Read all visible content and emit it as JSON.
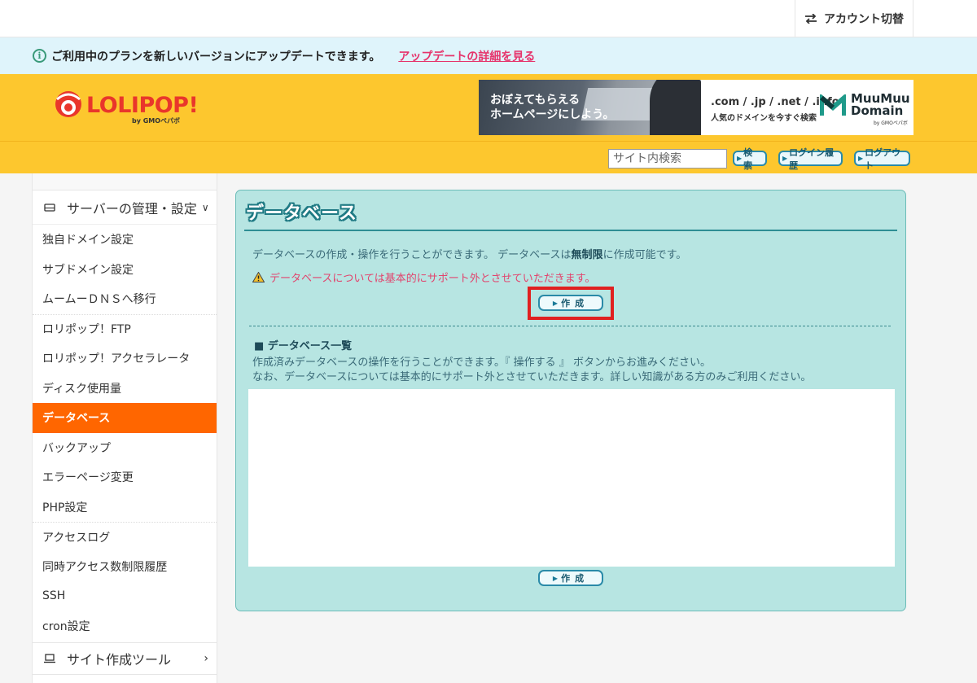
{
  "topbar": {
    "account_switch_label": "アカウント切替"
  },
  "notice": {
    "message": "ご利用中のプランを新しいバージョンにアップデートできます。",
    "link_label": "アップデートの詳細を見る"
  },
  "header": {
    "logo_text": "LOLIPOP!",
    "logo_sub": "by GMOペパボ",
    "banner": {
      "copy_line1": "おぼえてもらえる",
      "copy_line2": "ホームページにしよう。",
      "domains": ".com / .jp / .net / .info",
      "tagline": "人気のドメインを今すぐ検索",
      "brand_line1": "MuuMuu",
      "brand_line2": "Domain",
      "brand_sub": "by GMOペパボ"
    },
    "search_placeholder": "サイト内検索",
    "search_button": "検索",
    "login_history_button": "ログイン履歴",
    "logout_button": "ログアウト"
  },
  "sidebar": {
    "section_label": "サーバーの管理・設定",
    "items": [
      {
        "label": "独自ドメイン設定",
        "active": false
      },
      {
        "label": "サブドメイン設定",
        "active": false
      },
      {
        "label": "ムームーＤＮＳへ移行",
        "active": false
      },
      {
        "label": "ロリポップ！FTP",
        "active": false
      },
      {
        "label": "ロリポップ！アクセラレータ",
        "active": false
      },
      {
        "label": "ディスク使用量",
        "active": false
      },
      {
        "label": "データベース",
        "active": true
      },
      {
        "label": "バックアップ",
        "active": false
      },
      {
        "label": "エラーページ変更",
        "active": false
      },
      {
        "label": "PHP設定",
        "active": false
      },
      {
        "label": "アクセスログ",
        "active": false
      },
      {
        "label": "同時アクセス数制限履歴",
        "active": false
      },
      {
        "label": "SSH",
        "active": false
      },
      {
        "label": "cron設定",
        "active": false
      }
    ],
    "bottom_section_label": "サイト作成ツール"
  },
  "main": {
    "title": "データベース",
    "desc_before": "データベースの作成・操作を行うことができます。 データベースは",
    "desc_bold": "無制限",
    "desc_after": "に作成可能です。",
    "warning": "データベースについては基本的にサポート外とさせていただきます。",
    "create_button": "作成",
    "list_heading": "■ データベース一覧",
    "list_desc_line1": "作成済みデータベースの操作を行うことができます。『 操作する 』 ボタンからお進みください。",
    "list_desc_line2": "なお、データベースについては基本的にサポート外とさせていただきます。詳しい知識がある方のみご利用ください。"
  },
  "colors": {
    "header_yellow": "#fdc72e",
    "notice_blue": "#dff4fb",
    "active_orange": "#ff6600",
    "panel_teal": "#b7e5e2",
    "highlight_red": "#e02020",
    "warning_pink": "#e2446d"
  },
  "icons": [
    "swap-arrows-icon",
    "info-icon",
    "lolipop-logo-icon",
    "muumuu-logo-icon",
    "server-icon",
    "chevron-down-icon",
    "laptop-icon",
    "chevron-right-icon",
    "warning-icon",
    "play-arrow-icon"
  ]
}
